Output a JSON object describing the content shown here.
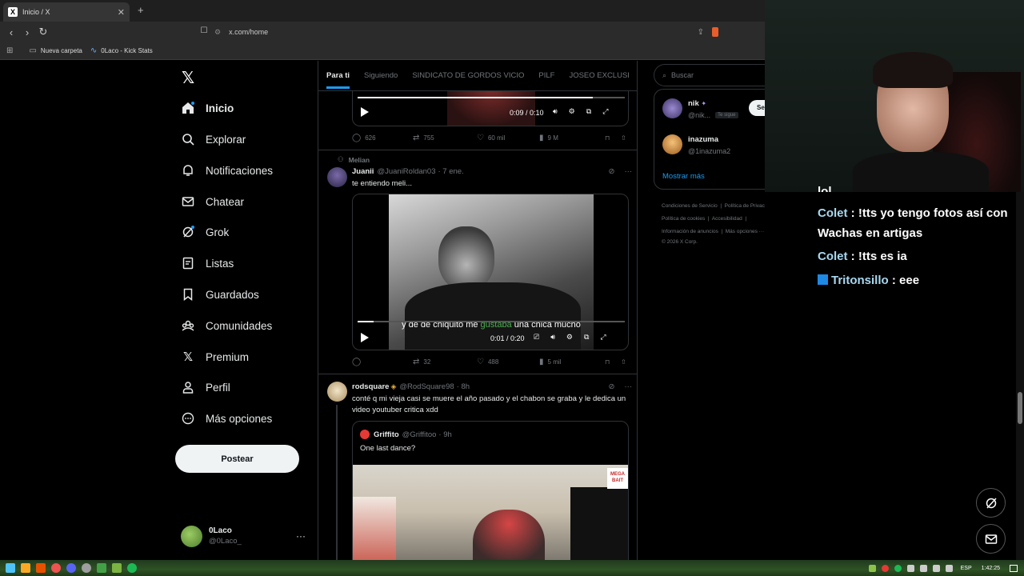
{
  "browser": {
    "tab_title": "Inicio / X",
    "new_tab_symbol": "+",
    "url": "x.com/home",
    "bookmarks": [
      "Nueva carpeta",
      "0Laco - Kick Stats"
    ]
  },
  "sidebar": {
    "items": [
      {
        "label": "Inicio",
        "icon": "home-icon"
      },
      {
        "label": "Explorar",
        "icon": "search-icon"
      },
      {
        "label": "Notificaciones",
        "icon": "bell-icon"
      },
      {
        "label": "Chatear",
        "icon": "mail-icon"
      },
      {
        "label": "Grok",
        "icon": "grok-icon"
      },
      {
        "label": "Listas",
        "icon": "list-icon"
      },
      {
        "label": "Guardados",
        "icon": "bookmark-icon"
      },
      {
        "label": "Comunidades",
        "icon": "communities-icon"
      },
      {
        "label": "Premium",
        "icon": "x-icon"
      },
      {
        "label": "Perfil",
        "icon": "person-icon"
      },
      {
        "label": "Más opciones",
        "icon": "more-icon"
      }
    ],
    "post_button": "Postear",
    "account": {
      "name": "0Laco",
      "handle": "@0Laco_"
    }
  },
  "timeline": {
    "tabs": [
      "Para ti",
      "Siguiendo",
      "SINDICATO DE GORDOS VICIO",
      "PILF",
      "JOSEO EXCLUSI"
    ],
    "post0": {
      "video_time": "0:09 / 0:10",
      "video_progress": 0.88,
      "replies": "626",
      "reposts": "755",
      "likes": "60 mil",
      "views": "9 M"
    },
    "post1": {
      "reposted_by": "Melian",
      "name": "Juanii",
      "handle": "@JuaniRoldan03",
      "time": "· 7 ene.",
      "text": "te entiendo meli...",
      "subtitle_before": "y de de chiquito me ",
      "subtitle_highlight": "gustaba",
      "subtitle_after": " una chica mucho",
      "video_time": "0:01 / 0:20",
      "video_progress": 0.06,
      "replies": "",
      "reposts": "32",
      "likes": "488",
      "views": "5 mil"
    },
    "post2": {
      "name": "rodsquare",
      "handle": "@RodSquare98",
      "time": "· 8h",
      "text": "conté q mi vieja casi se muere el año pasado y el chabon se graba y le dedica un video youtuber critica xdd",
      "quote": {
        "name": "Griffito",
        "handle": "@Griffitoo",
        "time": "· 9h",
        "text": "One last dance?",
        "badge": "MEGA BAIT"
      }
    }
  },
  "right": {
    "search_placeholder": "Buscar",
    "follows": [
      {
        "name": "nik",
        "handle": "@nik...",
        "tag": "Te sigue",
        "button": "Se"
      },
      {
        "name": "inazuma",
        "handle": "@1inazuma2"
      }
    ],
    "show_more": "Mostrar más",
    "footer": [
      "Condiciones de Servicio",
      "Política de Privacidad",
      "Política de cookies",
      "Accesibilidad",
      "Información de anuncios",
      "Más opciones ···",
      "© 2026 X Corp."
    ]
  },
  "chat": {
    "partial": "lol",
    "messages": [
      {
        "user": "Colet",
        "text": "!tts yo tengo fotos así con Wachas en artigas"
      },
      {
        "user": "Colet",
        "text": "!tts es ia"
      },
      {
        "user": "Tritonsillo",
        "text": "eee"
      }
    ]
  },
  "taskbar": {
    "lang": "ESP",
    "time": "1:42:25"
  },
  "colors": {
    "accent": "#1d9bf0",
    "chat_name": "#a8d8f0",
    "subtitle_highlight": "#4caf50"
  }
}
